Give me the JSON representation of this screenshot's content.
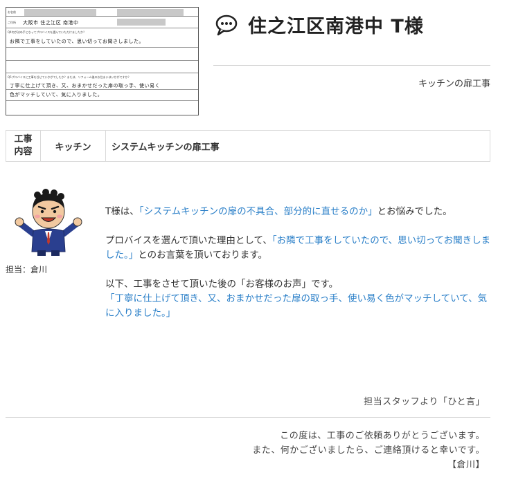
{
  "survey_form": {
    "name_label": "お名前",
    "address_label": "ご住所",
    "address_value": "大阪市 住之江区 南港中",
    "q1_label": "Q4何が決め手となってプロバイスを選んでいただけましたか？",
    "q1_answer": "お隣で工事をしていたので、思い切ってお聞きしました。",
    "q2_label": "Q5プロバイスに工事を任せていかがでしたか？または、リフォーム後のお住まいはいかがですか？",
    "q2_answer_line1": "丁寧に仕上げて頂き、又、おまかせだった扉の取っ手、使い易く",
    "q2_answer_line2": "色がマッチしていて、気に入りました。"
  },
  "header": {
    "title": "住之江区南港中 T様",
    "subtitle": "キッチンの扉工事"
  },
  "work": {
    "head_line1": "工事",
    "head_line2": "内容",
    "category": "キッチン",
    "description": "システムキッチンの扉工事"
  },
  "staff": {
    "name": "担当：倉川"
  },
  "message": {
    "p1_pre": "T様は、",
    "p1_hl": "「システムキッチンの扉の不具合、部分的に直せるのか」",
    "p1_post": "とお悩みでした。",
    "p2_pre": "プロバイスを選んで頂いた理由として、",
    "p2_hl": "「お隣で工事をしていたので、思い切ってお聞きしました。」",
    "p2_post": "とのお言葉を頂いております。",
    "p3_line1": "以下、工事をさせて頂いた後の「お客様のお声」です。",
    "p3_hl": "「丁寧に仕上げて頂き、又、おまかせだった扉の取っ手、使い易く色がマッチしていて、気に入りました。」"
  },
  "staff_word_heading": "担当スタッフより「ひと言」",
  "closing": {
    "line1": "この度は、工事のご依頼ありがとうございます。",
    "line2": "また、何かございましたら、ご連絡頂けると幸いです。",
    "signature": "【倉川】"
  },
  "colors": {
    "highlight": "#2a7fc8",
    "rule": "#cfcfcf"
  },
  "icons": {
    "title_icon": "speech-bubble-icon"
  }
}
